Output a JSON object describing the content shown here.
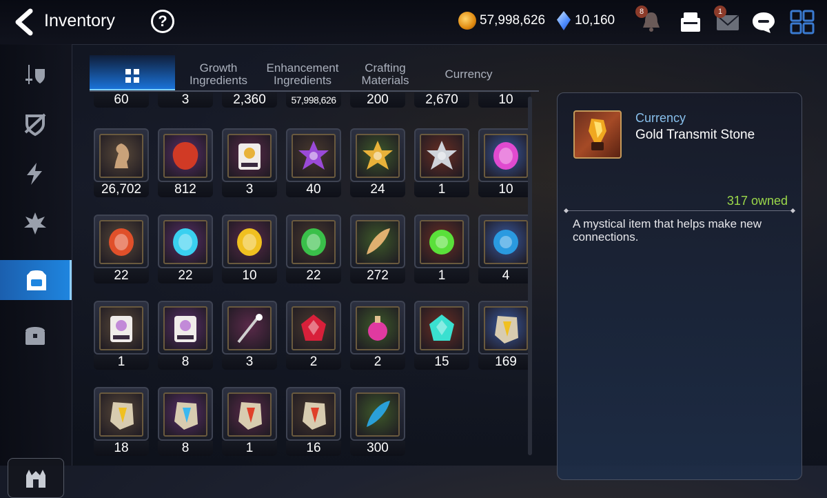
{
  "header": {
    "title": "Inventory",
    "help_label": "?",
    "gold": "57,998,626",
    "crystals": "10,160",
    "notifications_badge": "8",
    "mail_badge": "1"
  },
  "sidebar": {
    "items": [
      "equipment",
      "artifacts",
      "catalysts",
      "memory-imprint",
      "inventory",
      "storage"
    ],
    "active": 4
  },
  "tabs": [
    {
      "label": "",
      "icon": "grid-icon"
    },
    {
      "label": "Growth Ingredients"
    },
    {
      "label": "Enhancement Ingredients"
    },
    {
      "label": "Crafting Materials"
    },
    {
      "label": "Currency"
    }
  ],
  "top_row": [
    "60",
    "3",
    "2,360",
    "57,998,626",
    "200",
    "2,670",
    "10"
  ],
  "items": [
    {
      "qty": "26,702",
      "icon": "horse-chess-icon",
      "color": "#c9a27a"
    },
    {
      "qty": "812",
      "icon": "flame-heart-icon",
      "color": "#d13a25"
    },
    {
      "qty": "3",
      "icon": "pet-face-icon",
      "color": "#e8b23a"
    },
    {
      "qty": "40",
      "icon": "purple-flower-icon",
      "color": "#9a4ad8"
    },
    {
      "qty": "24",
      "icon": "gold-flower-icon",
      "color": "#e8b23a"
    },
    {
      "qty": "1",
      "icon": "silver-flower-icon",
      "color": "#cfd3da"
    },
    {
      "qty": "10",
      "icon": "pink-rune-icon",
      "color": "#e04ad0"
    },
    {
      "qty": "22",
      "icon": "fire-rune-icon",
      "color": "#e0502a"
    },
    {
      "qty": "22",
      "icon": "ice-rune-icon",
      "color": "#3ad0f0"
    },
    {
      "qty": "10",
      "icon": "light-rune-icon",
      "color": "#f0c020"
    },
    {
      "qty": "22",
      "icon": "earth-rune-icon",
      "color": "#3ac04a"
    },
    {
      "qty": "272",
      "icon": "feather-icon",
      "color": "#e0b070"
    },
    {
      "qty": "1",
      "icon": "green-orb-icon",
      "color": "#5ae03a"
    },
    {
      "qty": "4",
      "icon": "blue-sigil-icon",
      "color": "#2a9ae0"
    },
    {
      "qty": "1",
      "icon": "pet-pack-icon",
      "color": "#c28ad8"
    },
    {
      "qty": "8",
      "icon": "pet-pack-icon",
      "color": "#c28ad8"
    },
    {
      "qty": "3",
      "icon": "fishing-rod-icon",
      "color": "#d0d0d0"
    },
    {
      "qty": "2",
      "icon": "red-crystal-icon",
      "color": "#d8203a"
    },
    {
      "qty": "2",
      "icon": "potion-icon",
      "color": "#e03aa0"
    },
    {
      "qty": "15",
      "icon": "star-crystal-icon",
      "color": "#3ae0d0"
    },
    {
      "qty": "169",
      "icon": "yellow-stone-icon",
      "color": "#f0c020"
    },
    {
      "qty": "18",
      "icon": "bolt-stone-icon",
      "color": "#f0c020"
    },
    {
      "qty": "8",
      "icon": "star-stone-icon",
      "color": "#3ab8f0"
    },
    {
      "qty": "1",
      "icon": "t-stone-icon",
      "color": "#e0402a"
    },
    {
      "qty": "16",
      "icon": "bolt-stone-red-icon",
      "color": "#e0402a"
    },
    {
      "qty": "300",
      "icon": "blue-feather-icon",
      "color": "#2aa0d8"
    }
  ],
  "detail": {
    "category": "Currency",
    "name": "Gold Transmit Stone",
    "owned": "317 owned",
    "description": "A mystical item that helps make new connections."
  }
}
